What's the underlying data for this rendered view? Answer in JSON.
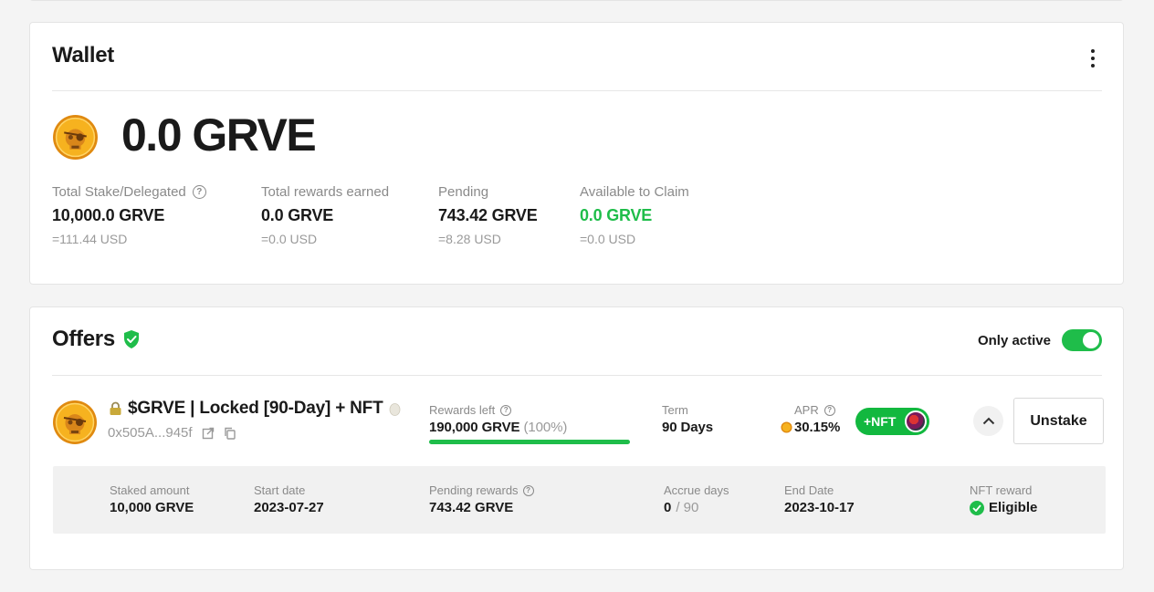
{
  "wallet": {
    "title": "Wallet",
    "balance": "0.0 GRVE",
    "stats": [
      {
        "label": "Total Stake/Delegated",
        "value": "10,000.0 GRVE",
        "usd": "=111.44 USD"
      },
      {
        "label": "Total rewards earned",
        "value": "0.0 GRVE",
        "usd": "=0.0 USD"
      },
      {
        "label": "Pending",
        "value": "743.42 GRVE",
        "usd": "=8.28 USD"
      },
      {
        "label": "Available to Claim",
        "value": "0.0 GRVE",
        "usd": "=0.0 USD"
      }
    ]
  },
  "offers": {
    "title": "Offers",
    "toggle_label": "Only active",
    "toggle_on": true,
    "offer": {
      "name": "$GRVE | Locked [90-Day] + NFT",
      "address": "0x505A...945f",
      "rewards_left_label": "Rewards left",
      "rewards_left_value": "190,000 GRVE",
      "rewards_left_percent": "(100%)",
      "rewards_left_fraction": 1.0,
      "term_label": "Term",
      "term_value": "90 Days",
      "apr_label": "APR",
      "apr_value": "30.15%",
      "nft_badge": "+NFT",
      "unstake_label": "Unstake"
    },
    "details": {
      "staked_amount_label": "Staked amount",
      "staked_amount_value": "10,000 GRVE",
      "start_date_label": "Start date",
      "start_date_value": "2023-07-27",
      "pending_rewards_label": "Pending rewards",
      "pending_rewards_value": "743.42 GRVE",
      "accrue_days_label": "Accrue days",
      "accrue_days_done": "0",
      "accrue_days_total": "/ 90",
      "end_date_label": "End Date",
      "end_date_value": "2023-10-17",
      "nft_reward_label": "NFT reward",
      "nft_reward_value": "Eligible"
    }
  },
  "colors": {
    "accent_green": "#1fbd4a",
    "coin_gold": "#f2a81d"
  }
}
